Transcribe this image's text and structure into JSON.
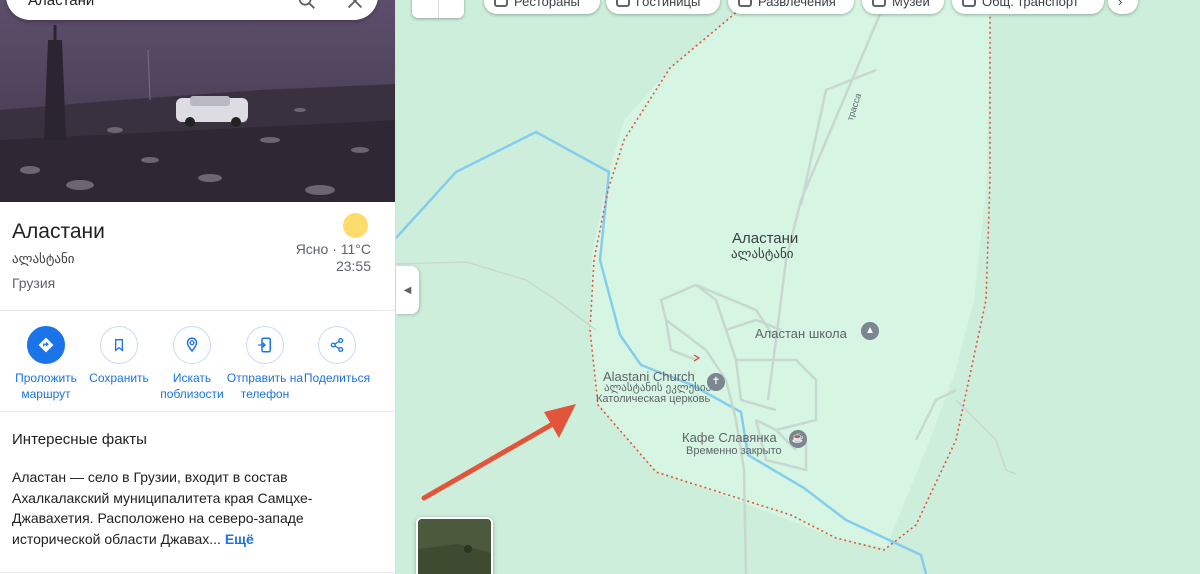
{
  "search": {
    "query": "Аластани"
  },
  "place": {
    "title": "Аластани",
    "subtitle": "ალასტანი",
    "country": "Грузия",
    "weather": "Ясно · 11°C",
    "time": "23:55"
  },
  "actions": [
    {
      "label": "Проложить маршрут",
      "icon": "directions-icon"
    },
    {
      "label": "Сохранить",
      "icon": "bookmark-icon"
    },
    {
      "label": "Искать поблизости",
      "icon": "nearby-icon"
    },
    {
      "label": "Отправить на телефон",
      "icon": "send-to-phone-icon"
    },
    {
      "label": "Поделиться",
      "icon": "share-icon"
    }
  ],
  "facts": {
    "title": "Интересные факты",
    "text": "Аластан — село в Грузии, входит в состав Ахалкалакский муниципалитета края Самцхе-Джавахетия. Расположено на северо-западе исторической области Джавах...",
    "more": "Ещё"
  },
  "chips": [
    {
      "label": "Рестораны",
      "icon": "restaurant-icon"
    },
    {
      "label": "Гостиницы",
      "icon": "hotel-icon"
    },
    {
      "label": "Развлечения",
      "icon": "camera-icon"
    },
    {
      "label": "Музеи",
      "icon": "museum-icon"
    },
    {
      "label": "Общ. транспорт",
      "icon": "transit-icon"
    }
  ],
  "map": {
    "town_name": "Аластани",
    "town_name_geo": "ალასტანი",
    "road_label": "трасса",
    "pois": [
      {
        "name": "Аластан школа",
        "icon": "school-icon"
      },
      {
        "name": "Alastani Church",
        "geo": "ალასტანის ეკლესია",
        "sub": "Католическая церковь",
        "icon": "church-icon"
      },
      {
        "name": "Кафе Славянка",
        "sub": "Временно закрыто",
        "icon": "cafe-icon"
      }
    ]
  },
  "colors": {
    "accent": "#1a73e8",
    "map_bg": "#cdeedb",
    "boundary": "#e2553b",
    "river": "#7fc8ec",
    "arrow": "#e2553b"
  }
}
